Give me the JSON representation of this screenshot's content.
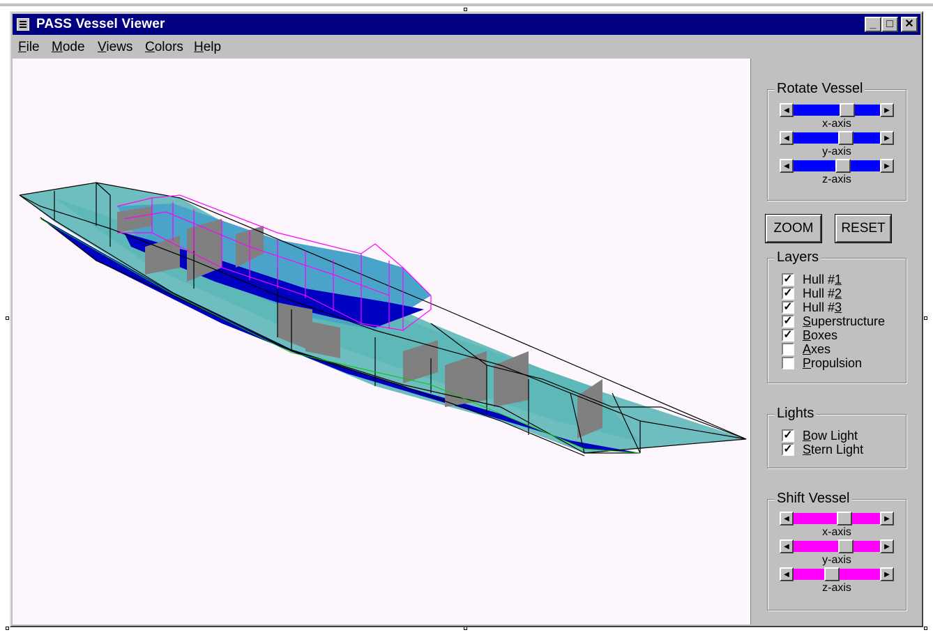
{
  "window": {
    "title": "PASS Vessel Viewer",
    "controls": {
      "minimize": "_",
      "maximize": "□",
      "close": "✕"
    }
  },
  "menu": {
    "items": [
      {
        "label": "File",
        "accel": "F",
        "rest": "ile"
      },
      {
        "label": "Mode",
        "accel": "M",
        "rest": "ode"
      },
      {
        "label": "Views",
        "accel": "V",
        "rest": "iews"
      },
      {
        "label": "Colors",
        "accel": "C",
        "rest": "olors"
      },
      {
        "label": "Help",
        "accel": "H",
        "rest": "elp"
      }
    ]
  },
  "rotate": {
    "title": "Rotate Vessel",
    "color": "#0000ff",
    "sliders": [
      {
        "label": "x-axis",
        "value": 0.55
      },
      {
        "label": "y-axis",
        "value": 0.52
      },
      {
        "label": "z-axis",
        "value": 0.5
      }
    ]
  },
  "buttons": {
    "zoom": "ZOOM",
    "reset": "RESET"
  },
  "layers": {
    "title": "Layers",
    "items": [
      {
        "pre": "Hull #",
        "accel": "1",
        "post": "",
        "checked": true
      },
      {
        "pre": "Hull #",
        "accel": "2",
        "post": "",
        "checked": true
      },
      {
        "pre": "Hull #",
        "accel": "3",
        "post": "",
        "checked": true
      },
      {
        "pre": "",
        "accel": "S",
        "post": "uperstructure",
        "checked": true
      },
      {
        "pre": "",
        "accel": "B",
        "post": "oxes",
        "checked": true
      },
      {
        "pre": "",
        "accel": "A",
        "post": "xes",
        "checked": false
      },
      {
        "pre": "",
        "accel": "P",
        "post": "ropulsion",
        "checked": false
      }
    ]
  },
  "lights": {
    "title": "Lights",
    "items": [
      {
        "pre": "",
        "accel": "B",
        "post": "ow Light",
        "checked": true
      },
      {
        "pre": "",
        "accel": "S",
        "post": "tern Light",
        "checked": true
      }
    ]
  },
  "shift": {
    "title": "Shift Vessel",
    "color": "#ff00ff",
    "sliders": [
      {
        "label": "x-axis",
        "value": 0.5
      },
      {
        "label": "y-axis",
        "value": 0.52
      },
      {
        "label": "z-axis",
        "value": 0.42
      }
    ]
  },
  "colors": {
    "viewport_bg": "#fdf6fd",
    "hull_wire": "#000000",
    "superstructure_wire": "#ff00ff",
    "hull_fill": "#5fb8b8",
    "keel": "#0000c0",
    "box": "#808080"
  }
}
